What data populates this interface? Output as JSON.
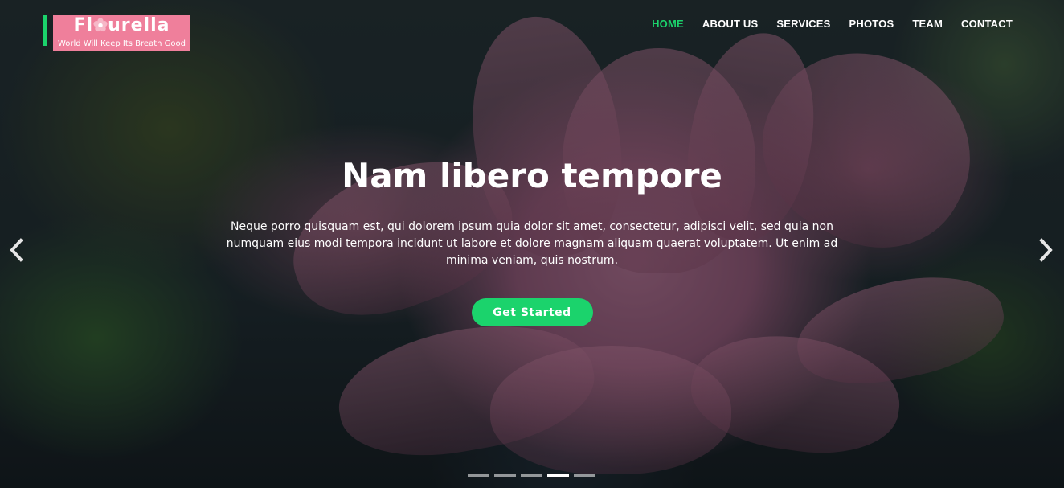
{
  "brand": {
    "title_part1": "Fl",
    "title_part2": "urella",
    "tagline": "World Will Keep Its Breath Good",
    "logo_bg_color": "#ef7f9b"
  },
  "nav": {
    "items": [
      {
        "label": "HOME",
        "active": true
      },
      {
        "label": "ABOUT US",
        "active": false
      },
      {
        "label": "SERVICES",
        "active": false
      },
      {
        "label": "PHOTOS",
        "active": false
      },
      {
        "label": "TEAM",
        "active": false
      },
      {
        "label": "CONTACT",
        "active": false
      }
    ]
  },
  "hero": {
    "headline": "Nam libero tempore",
    "paragraph": "Neque porro quisquam est, qui dolorem ipsum quia dolor sit amet, consectetur, adipisci velit, sed quia non numquam eius modi tempora incidunt ut labore et dolore magnam aliquam quaerat voluptatem. Ut enim ad minima veniam, quis nostrum.",
    "cta_label": "Get Started"
  },
  "carousel": {
    "prev_icon": "chevron-left-icon",
    "next_icon": "chevron-right-icon",
    "slide_count": 5,
    "active_index": 3
  },
  "colors": {
    "accent": "#1bd36c",
    "text": "#ffffff"
  }
}
